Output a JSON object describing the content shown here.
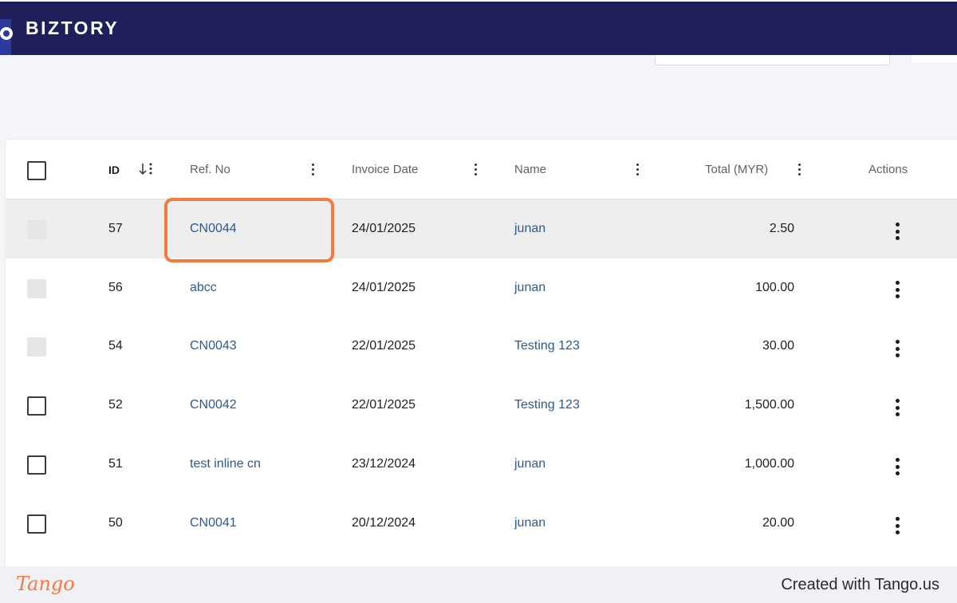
{
  "app": {
    "logo_text": "BIZTORY"
  },
  "table": {
    "headers": {
      "id": "ID",
      "ref_no": "Ref. No",
      "invoice_date": "Invoice Date",
      "name": "Name",
      "total": "Total (MYR)",
      "actions": "Actions"
    },
    "rows": [
      {
        "id": "57",
        "ref_no": "CN0044",
        "invoice_date": "24/01/2025",
        "name": "junan",
        "total": "2.50",
        "selectable": false
      },
      {
        "id": "56",
        "ref_no": "abcc",
        "invoice_date": "24/01/2025",
        "name": "junan",
        "total": "100.00",
        "selectable": false
      },
      {
        "id": "54",
        "ref_no": "CN0043",
        "invoice_date": "22/01/2025",
        "name": "Testing 123",
        "total": "30.00",
        "selectable": false
      },
      {
        "id": "52",
        "ref_no": "CN0042",
        "invoice_date": "22/01/2025",
        "name": "Testing 123",
        "total": "1,500.00",
        "selectable": true
      },
      {
        "id": "51",
        "ref_no": "test inline cn",
        "invoice_date": "23/12/2024",
        "name": "junan",
        "total": "1,000.00",
        "selectable": true
      },
      {
        "id": "50",
        "ref_no": "CN0041",
        "invoice_date": "20/12/2024",
        "name": "junan",
        "total": "20.00",
        "selectable": true
      }
    ]
  },
  "footer": {
    "logo": "Tango",
    "credit": "Created with Tango.us"
  },
  "colors": {
    "topbar": "#1f1f5c",
    "link": "#2c5a8f",
    "highlight_outline": "#f47b40"
  }
}
